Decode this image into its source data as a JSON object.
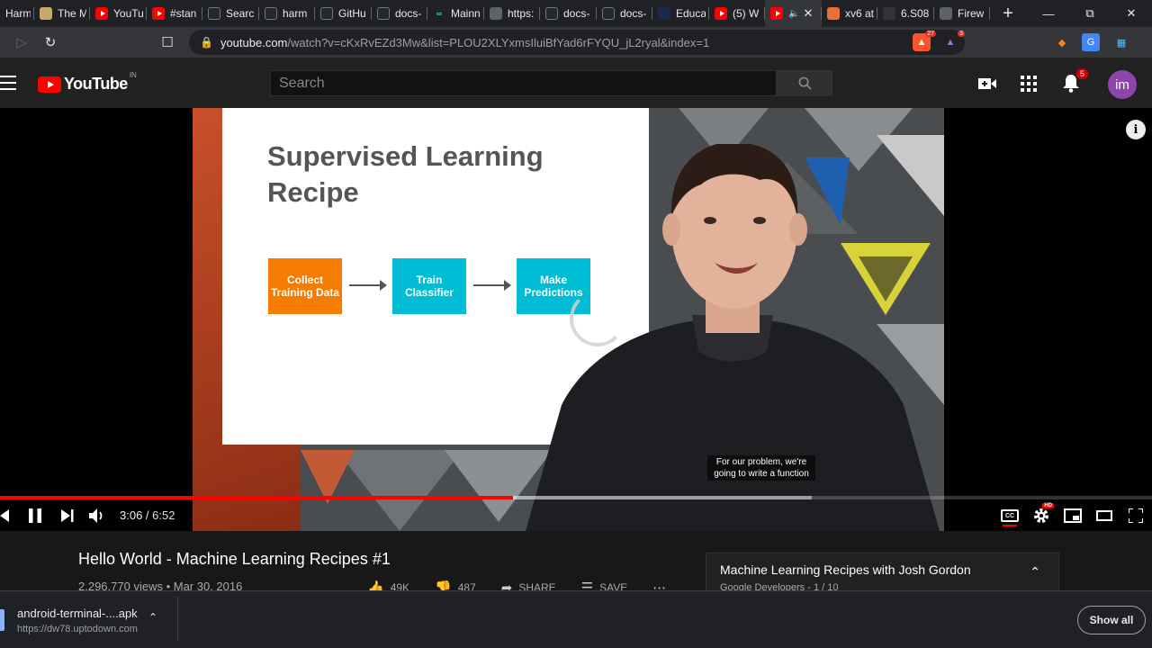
{
  "browser": {
    "tabs": [
      {
        "label": "Harm",
        "icon": "page-icon"
      },
      {
        "label": "The M",
        "icon": "page-icon"
      },
      {
        "label": "YouTu",
        "icon": "youtube-icon"
      },
      {
        "label": "#stan",
        "icon": "youtube-icon"
      },
      {
        "label": "Searc",
        "icon": "github-icon"
      },
      {
        "label": "harm",
        "icon": "github-icon"
      },
      {
        "label": "GitHu",
        "icon": "github-icon"
      },
      {
        "label": "docs-",
        "icon": "github-icon"
      },
      {
        "label": "Mainn",
        "icon": "page-icon"
      },
      {
        "label": "https:",
        "icon": "globe-icon"
      },
      {
        "label": "docs-",
        "icon": "github-icon"
      },
      {
        "label": "docs-",
        "icon": "github-icon"
      },
      {
        "label": "Educa",
        "icon": "page-icon"
      },
      {
        "label": "(5) W",
        "icon": "youtube-icon"
      },
      {
        "label": "",
        "icon": "youtube-icon"
      },
      {
        "label": "xv6 at",
        "icon": "brave-icon"
      },
      {
        "label": "6.S08",
        "icon": "page-icon"
      },
      {
        "label": "Firew",
        "icon": "globe-icon"
      }
    ],
    "url_host": "youtube.com",
    "url_path": "/watch?v=cKxRvEZd3Mw&list=PLOU2XLYxmsIluiBfYad6rFYQU_jL2ryal&index=1",
    "brave_count": "27",
    "rewards_count": "3"
  },
  "youtube": {
    "logo_text": "YouTube",
    "country": "IN",
    "search_placeholder": "Search",
    "notification_count": "5",
    "avatar_letter": "im"
  },
  "slide": {
    "title": "Supervised Learning Recipe",
    "steps": [
      "Collect Training Data",
      "Train Classifier",
      "Make Predictions"
    ],
    "step_colors": [
      "#f57c00",
      "#00bcd4",
      "#00bcd4"
    ]
  },
  "player": {
    "caption": "For our problem, we're going to write a function",
    "current_time": "3:06",
    "duration": "6:52",
    "played_fraction": 0.445,
    "buffered_fraction": 0.705,
    "info_label": "i"
  },
  "video": {
    "title": "Hello World - Machine Learning Recipes #1",
    "views": "2,296,770 views",
    "date": "Mar 30, 2016",
    "likes": "49K",
    "dislikes": "487",
    "share_label": "SHARE",
    "save_label": "SAVE"
  },
  "playlist": {
    "title": "Machine Learning Recipes with Josh Gordon",
    "subtitle": "Google Developers - 1 / 10"
  },
  "download": {
    "filename": "android-terminal-....apk",
    "source": "https://dw78.uptodown.com",
    "show_all_label": "Show all"
  }
}
